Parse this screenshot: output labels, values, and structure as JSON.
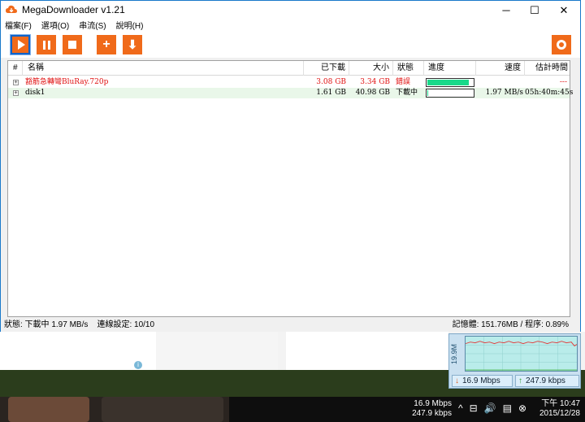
{
  "window": {
    "title": "MegaDownloader v1.21",
    "minimize_glyph": "─",
    "maximize_glyph": "☐",
    "close_glyph": "✕"
  },
  "menu": [
    "檔案(F)",
    "選項(O)",
    "串流(S)",
    "說明(H)"
  ],
  "toolbar": {
    "icons": [
      "play-icon",
      "pause-icon",
      "stop-icon",
      "add-icon",
      "download-icon",
      "settings-icon"
    ],
    "accent_color": "#f06a1a",
    "add_glyph": "+",
    "download_glyph": "⬇"
  },
  "columns": {
    "num": "#",
    "name": "名稱",
    "downloaded": "已下載",
    "size": "大小",
    "status": "狀態",
    "progress": "進度",
    "speed": "速度",
    "eta": "估計時間"
  },
  "rows": [
    {
      "name": "豁筋急轉彎BluRay.720p",
      "downloaded": "3.08 GB",
      "size": "3.34 GB",
      "status": "錯誤",
      "progress": 0.92,
      "speed": "",
      "eta": "---",
      "color": "#e01010",
      "expander": "+"
    },
    {
      "name": "disk1",
      "downloaded": "1.61 GB",
      "size": "40.98 GB",
      "status": "下載中",
      "progress": 0.04,
      "speed": "1.97 MB/s",
      "eta": "05h:40m:45s",
      "color": "#000000",
      "expander": "+"
    }
  ],
  "statusbar": {
    "left": "狀態: 下載中 1.97 MB/s    連線設定: 10/10",
    "right": "記憶體: 151.76MB / 程序: 0.89%"
  },
  "netmon": {
    "ylabel": "19.9M",
    "download": "16.9 Mbps",
    "upload": "247.9 kbps",
    "down_arrow": "↓",
    "up_arrow": "↑"
  },
  "taskbar": {
    "speed_down": "16.9 Mbps",
    "speed_up": "247.9 kbps",
    "clock_time": "下午 10:47",
    "clock_date": "2015/12/28",
    "tray_glyphs": [
      "^",
      "⊟",
      "🔊",
      "▤",
      "⊗"
    ]
  },
  "desktop": {
    "info_glyph": "i"
  }
}
